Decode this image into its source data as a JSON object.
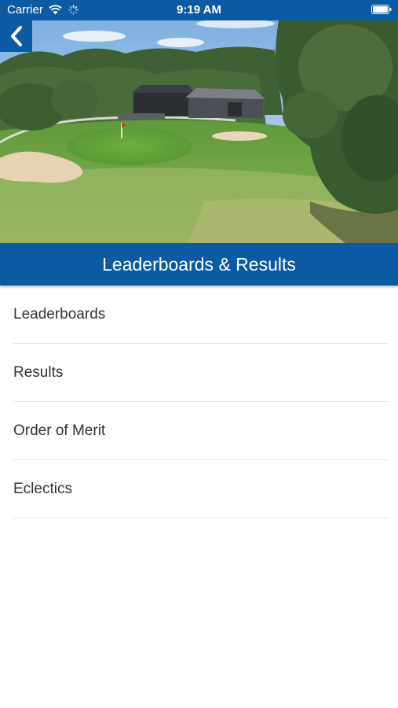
{
  "status_bar": {
    "carrier": "Carrier",
    "time": "9:19 AM",
    "wifi_icon": "wifi-icon",
    "activity_icon": "activity-spinner-icon",
    "battery_icon": "battery-icon"
  },
  "nav": {
    "back_icon": "chevron-left-icon"
  },
  "hero": {
    "image": "golf-course-clubhouse-photo"
  },
  "header": {
    "title": "Leaderboards & Results"
  },
  "menu": {
    "items": [
      {
        "label": "Leaderboards"
      },
      {
        "label": "Results"
      },
      {
        "label": "Order of Merit"
      },
      {
        "label": "Eclectics"
      }
    ]
  },
  "colors": {
    "brand_blue": "#0b5aa3",
    "divider": "#e6e6e6",
    "text": "#333333"
  }
}
